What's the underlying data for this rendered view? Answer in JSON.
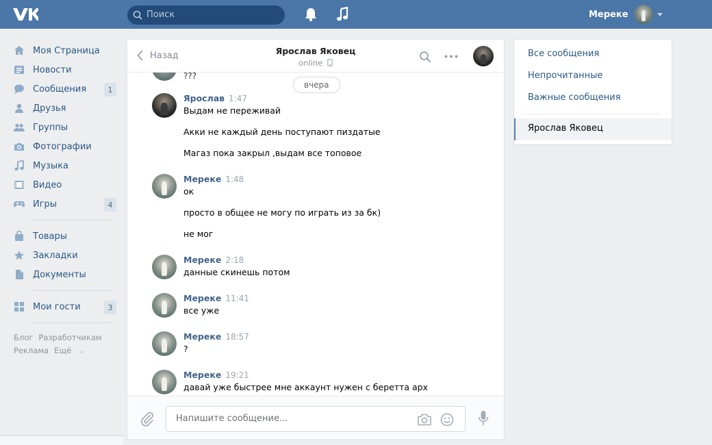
{
  "header": {
    "search_placeholder": "Поиск",
    "user_name": "Мереке"
  },
  "sidebar": {
    "items": [
      {
        "label": "Моя Страница",
        "icon": "home-icon",
        "badge": ""
      },
      {
        "label": "Новости",
        "icon": "news-icon",
        "badge": ""
      },
      {
        "label": "Сообщения",
        "icon": "messages-icon",
        "badge": "1"
      },
      {
        "label": "Друзья",
        "icon": "friends-icon",
        "badge": ""
      },
      {
        "label": "Группы",
        "icon": "groups-icon",
        "badge": ""
      },
      {
        "label": "Фотографии",
        "icon": "camera-icon",
        "badge": ""
      },
      {
        "label": "Музыка",
        "icon": "music-icon",
        "badge": ""
      },
      {
        "label": "Видео",
        "icon": "video-icon",
        "badge": ""
      },
      {
        "label": "Игры",
        "icon": "gamepad-icon",
        "badge": "4"
      },
      {
        "label": "Товары",
        "icon": "shopping-bag-icon",
        "badge": ""
      },
      {
        "label": "Закладки",
        "icon": "star-icon",
        "badge": ""
      },
      {
        "label": "Документы",
        "icon": "document-icon",
        "badge": ""
      },
      {
        "label": "Мои гости",
        "icon": "grid-icon",
        "badge": "3"
      }
    ],
    "footer": {
      "blog": "Блог",
      "developers": "Разработчикам",
      "ads": "Реклама",
      "more": "Ещё"
    }
  },
  "chat": {
    "back_label": "Назад",
    "peer_name": "Ярослав Яковец",
    "peer_status": "online",
    "date_divider": "вчера",
    "cut_text": "???",
    "messages": [
      {
        "author": "Ярослав",
        "time": "1:47",
        "lines": [
          "Выдам не переживай",
          "Акки не каждый день поступают пиздатые",
          "Магаз пока закрыл ,выдам все топовое"
        ]
      },
      {
        "author": "Мереке",
        "time": "1:48",
        "lines": [
          "ок",
          "просто в общее не могу по играть из за бк)",
          "не мог"
        ]
      },
      {
        "author": "Мереке",
        "time": "2:18",
        "lines": [
          "данные скинешь потом"
        ]
      },
      {
        "author": "Мереке",
        "time": "11:41",
        "lines": [
          "все уже"
        ]
      },
      {
        "author": "Мереке",
        "time": "18:57",
        "lines": [
          "?"
        ]
      },
      {
        "author": "Мереке",
        "time": "19:21",
        "lines": [
          "давай уже быстрее мне аккаунт нужен с беретта арх"
        ]
      }
    ],
    "composer_placeholder": "Напишите сообщение..."
  },
  "right_menu": {
    "all": "Все сообщения",
    "unread": "Непрочитанные",
    "important": "Важные сообщения",
    "current": "Ярослав Яковец"
  },
  "colors": {
    "header": "#4a76a8",
    "link": "#2a5885",
    "author": "#42648b",
    "background": "#edeef0"
  }
}
